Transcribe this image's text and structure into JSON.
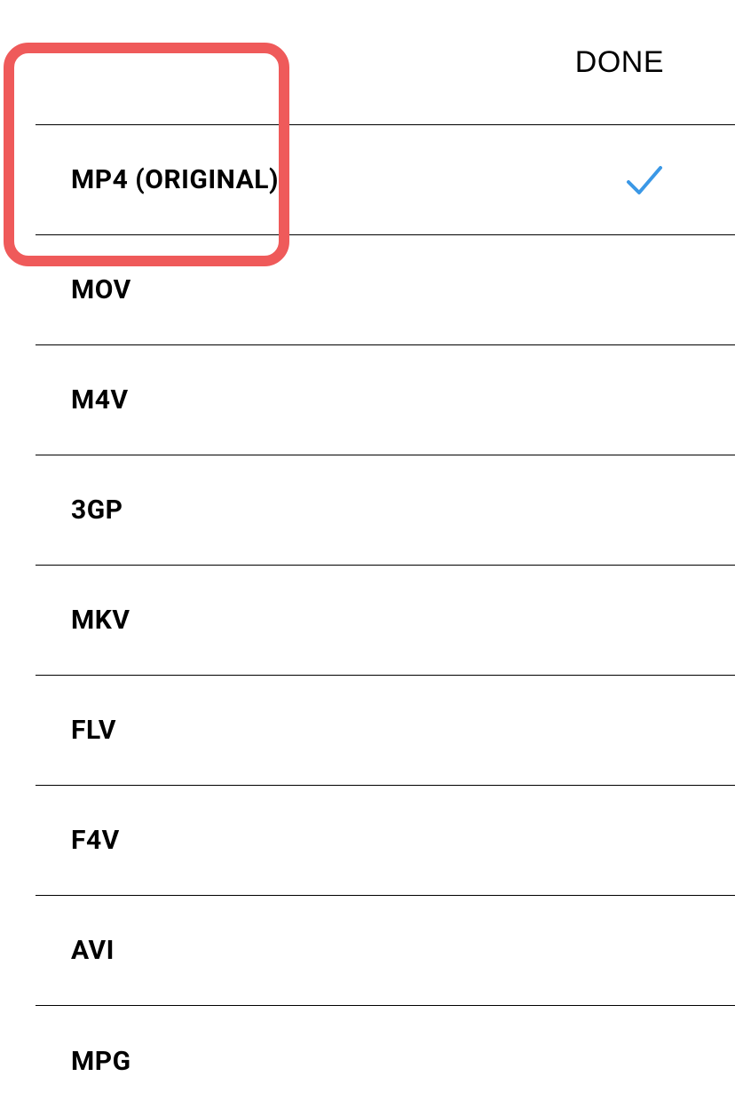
{
  "header": {
    "done_label": "DONE"
  },
  "formats": [
    {
      "label": "MP4 (ORIGINAL)",
      "selected": true
    },
    {
      "label": "MOV",
      "selected": false
    },
    {
      "label": "M4V",
      "selected": false
    },
    {
      "label": "3GP",
      "selected": false
    },
    {
      "label": "MKV",
      "selected": false
    },
    {
      "label": "FLV",
      "selected": false
    },
    {
      "label": "F4V",
      "selected": false
    },
    {
      "label": "AVI",
      "selected": false
    },
    {
      "label": "MPG",
      "selected": false
    }
  ],
  "colors": {
    "checkmark": "#3b98e6",
    "highlight": "#ef5a5a"
  }
}
